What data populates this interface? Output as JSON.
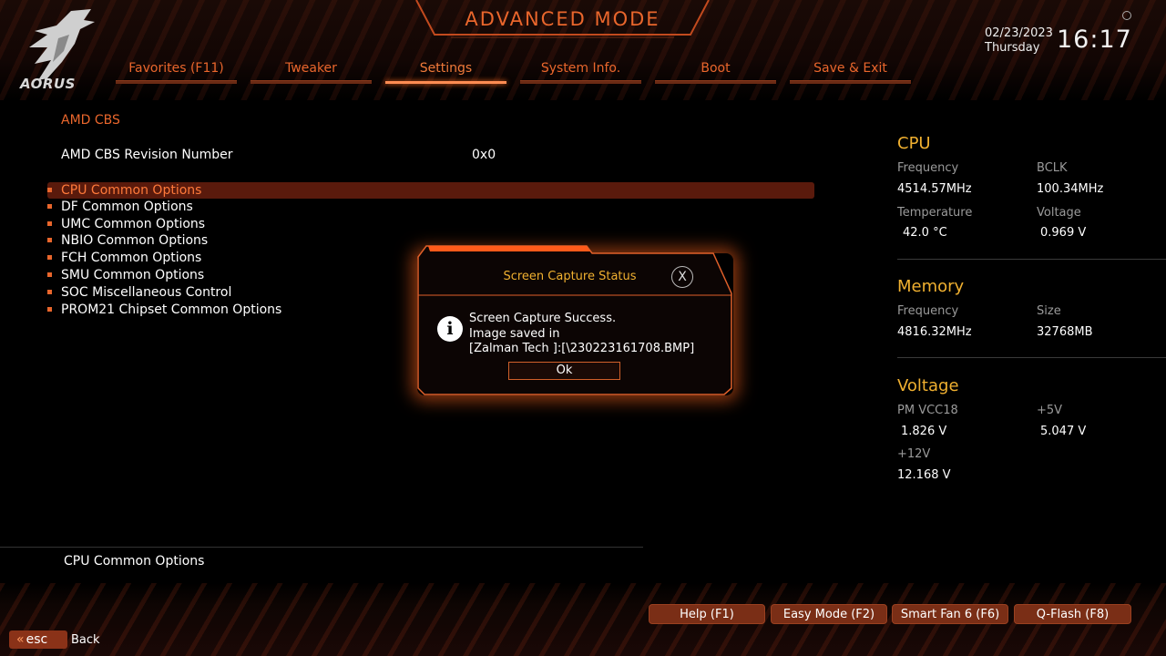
{
  "header": {
    "title": "ADVANCED MODE",
    "logo_text": "AORUS",
    "date": "02/23/2023",
    "weekday": "Thursday",
    "time": "16:17"
  },
  "tabs": [
    {
      "label": "Favorites (F11)"
    },
    {
      "label": "Tweaker"
    },
    {
      "label": "Settings"
    },
    {
      "label": "System Info."
    },
    {
      "label": "Boot"
    },
    {
      "label": "Save & Exit"
    }
  ],
  "active_tab": "Settings",
  "main": {
    "section_title": "AMD CBS",
    "revision_label": "AMD CBS Revision Number",
    "revision_value": "0x0",
    "menu": [
      {
        "label": "CPU Common Options"
      },
      {
        "label": "DF Common Options"
      },
      {
        "label": "UMC Common Options"
      },
      {
        "label": "NBIO Common Options"
      },
      {
        "label": "FCH Common Options"
      },
      {
        "label": "SMU Common Options"
      },
      {
        "label": "SOC Miscellaneous Control"
      },
      {
        "label": "PROM21 Chipset Common Options"
      }
    ],
    "selected_item": "CPU Common Options",
    "help_text": "CPU Common Options"
  },
  "right_panel": {
    "cpu": {
      "title": "CPU",
      "frequency_label": "Frequency",
      "frequency_value": "4514.57MHz",
      "bclk_label": "BCLK",
      "bclk_value": "100.34MHz",
      "temperature_label": "Temperature",
      "temperature_value": "42.0 °C",
      "voltage_label": "Voltage",
      "voltage_value": "0.969 V"
    },
    "memory": {
      "title": "Memory",
      "frequency_label": "Frequency",
      "frequency_value": "4816.32MHz",
      "size_label": "Size",
      "size_value": "32768MB"
    },
    "voltage": {
      "title": "Voltage",
      "pm_vcc18_label": "PM VCC18",
      "pm_vcc18_value": "1.826 V",
      "p5v_label": "+5V",
      "p5v_value": "5.047 V",
      "p12v_label": "+12V",
      "p12v_value": "12.168 V"
    }
  },
  "dialog": {
    "title": "Screen Capture Status",
    "close_glyph": "X",
    "icon_glyph": "i",
    "line1": "Screen Capture Success.",
    "line2": "Image saved in",
    "line3": "[Zalman Tech ]:[\\230223161708.BMP]",
    "ok_label": "Ok"
  },
  "footer": {
    "buttons": [
      {
        "label": "Help (F1)"
      },
      {
        "label": "Easy Mode (F2)"
      },
      {
        "label": "Smart Fan 6 (F6)"
      },
      {
        "label": "Q-Flash (F8)"
      }
    ],
    "esc_label": "esc",
    "back_label": "Back"
  },
  "colors": {
    "accent": "#e9662c",
    "highlight": "#f0b030",
    "selected_row": "#5a1a0c",
    "button_bg": "#7a2e16"
  }
}
